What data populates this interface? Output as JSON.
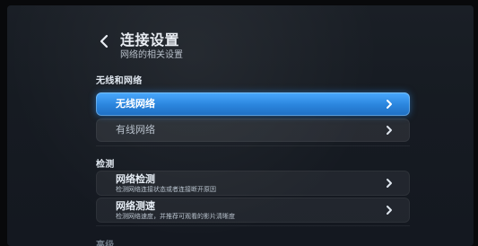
{
  "header": {
    "back_icon": "chevron-left-icon",
    "title": "连接设置",
    "subtitle": "网络的相关设置"
  },
  "sections": [
    {
      "label": "无线和网络",
      "items": [
        {
          "label": "无线网络",
          "selected": true,
          "icon": "chevron-right-icon"
        },
        {
          "label": "有线网络",
          "selected": false,
          "icon": "chevron-right-icon"
        }
      ]
    },
    {
      "label": "检测",
      "items": [
        {
          "label": "网络检测",
          "description": "检测网络连接状态或者连接断开原因",
          "icon": "chevron-right-icon"
        },
        {
          "label": "网络测速",
          "description": "检测网络速度，并推荐可观看的影片清晰度",
          "icon": "chevron-right-icon"
        }
      ]
    },
    {
      "label": "高级"
    }
  ],
  "colors": {
    "accent": "#2f8be0",
    "background": "#161b22",
    "text_primary": "#e9edf3",
    "text_secondary": "#b7c0cb"
  }
}
